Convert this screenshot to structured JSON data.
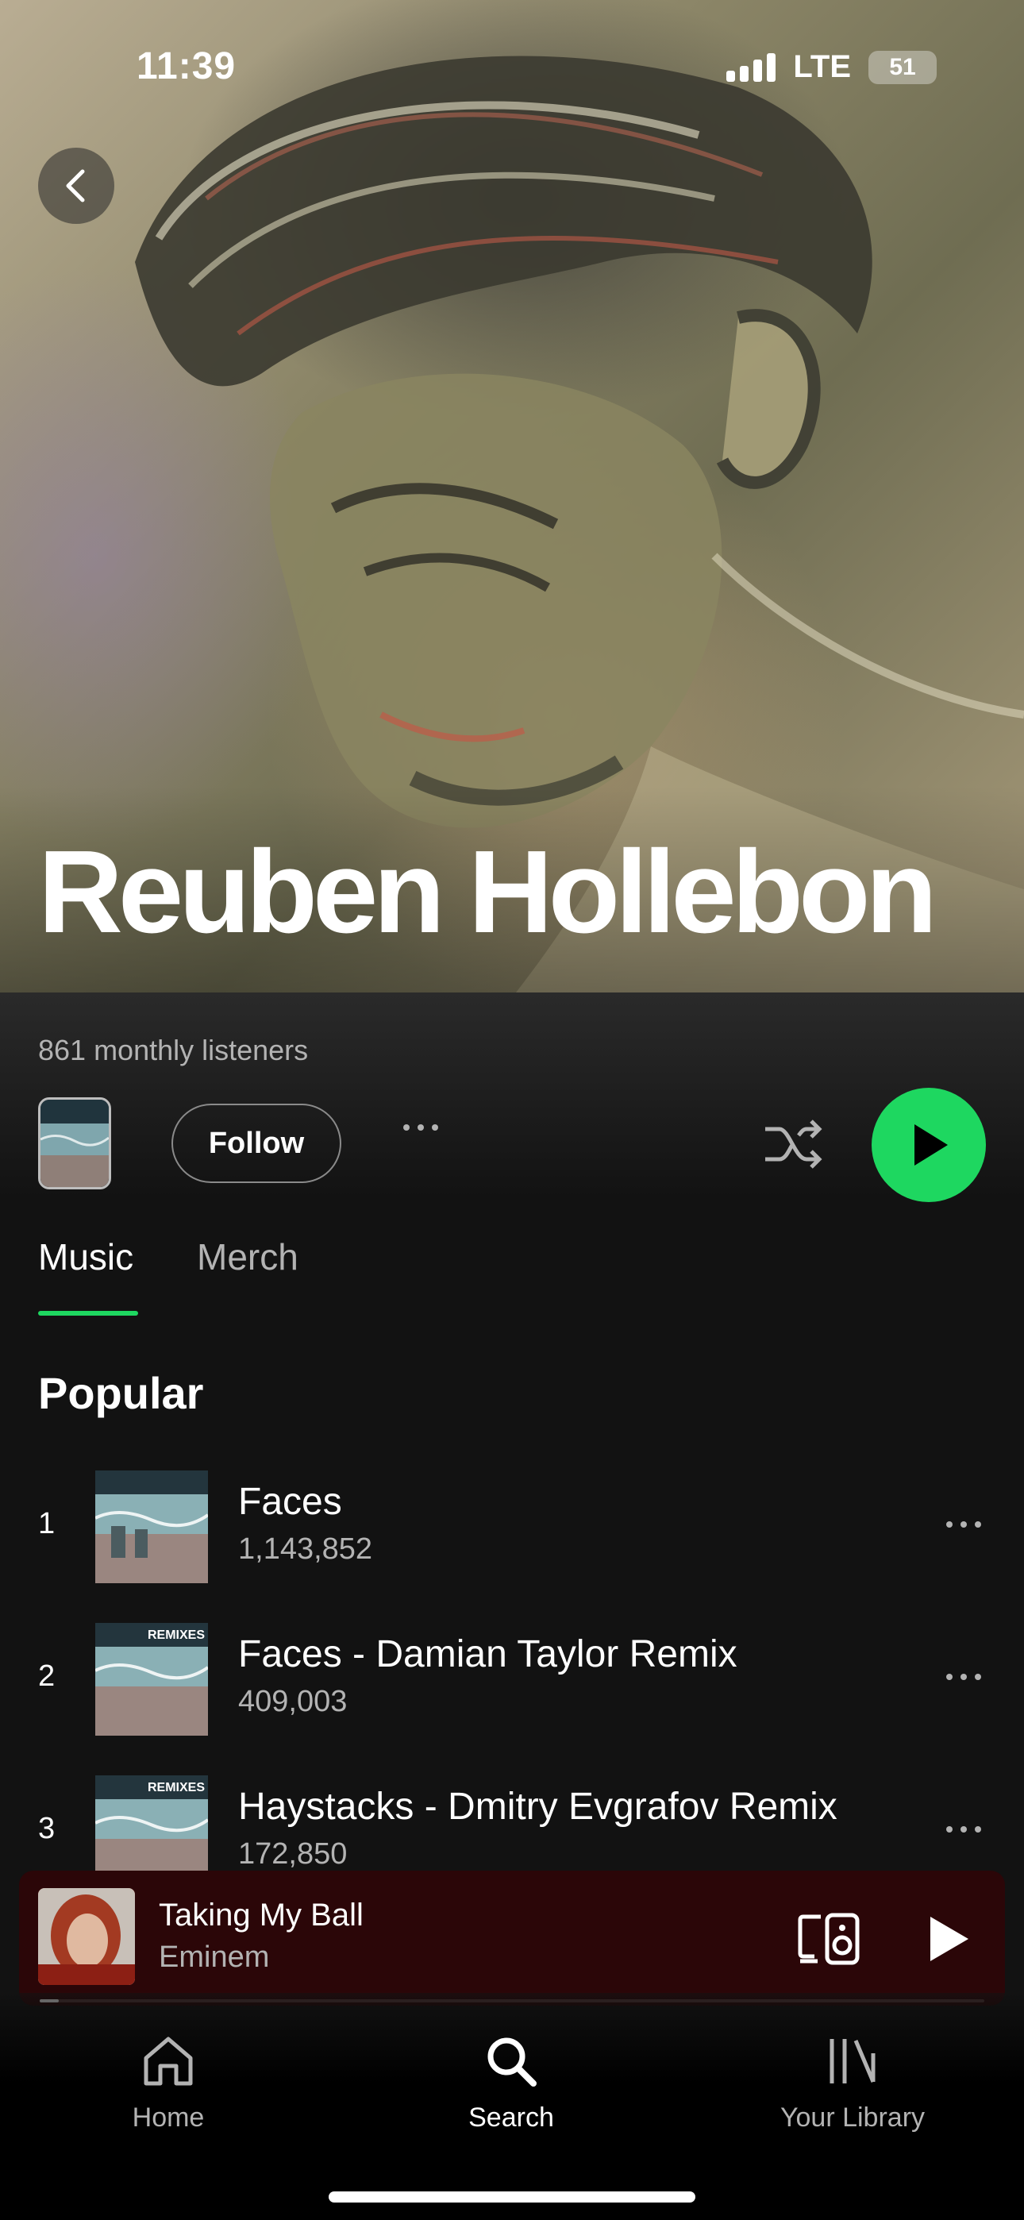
{
  "status_bar": {
    "time": "11:39",
    "network": "LTE",
    "battery": "51"
  },
  "artist": {
    "name": "Reuben Hollebon",
    "monthly_listeners": "861 monthly listeners",
    "follow_label": "Follow"
  },
  "tabs": [
    {
      "label": "Music",
      "active": true
    },
    {
      "label": "Merch",
      "active": false
    }
  ],
  "popular": {
    "title": "Popular",
    "tracks": [
      {
        "rank": "1",
        "title": "Faces",
        "plays": "1,143,852",
        "art_label": ""
      },
      {
        "rank": "2",
        "title": "Faces - Damian Taylor Remix",
        "plays": "409,003",
        "art_label": "REMIXES"
      },
      {
        "rank": "3",
        "title": "Haystacks - Dmitry Evgrafov Remix",
        "plays": "172,850",
        "art_label": "REMIXES"
      }
    ]
  },
  "now_playing": {
    "title": "Taking My Ball",
    "artist": "Eminem",
    "progress": 0.02,
    "bg_color": "#2b0608"
  },
  "nav": [
    {
      "label": "Home",
      "icon": "home-icon",
      "active": false
    },
    {
      "label": "Search",
      "icon": "search-icon",
      "active": true
    },
    {
      "label": "Your Library",
      "icon": "library-icon",
      "active": false
    }
  ],
  "colors": {
    "accent": "#1ed760",
    "background": "#121212",
    "secondary_text": "#b3b3b3"
  }
}
